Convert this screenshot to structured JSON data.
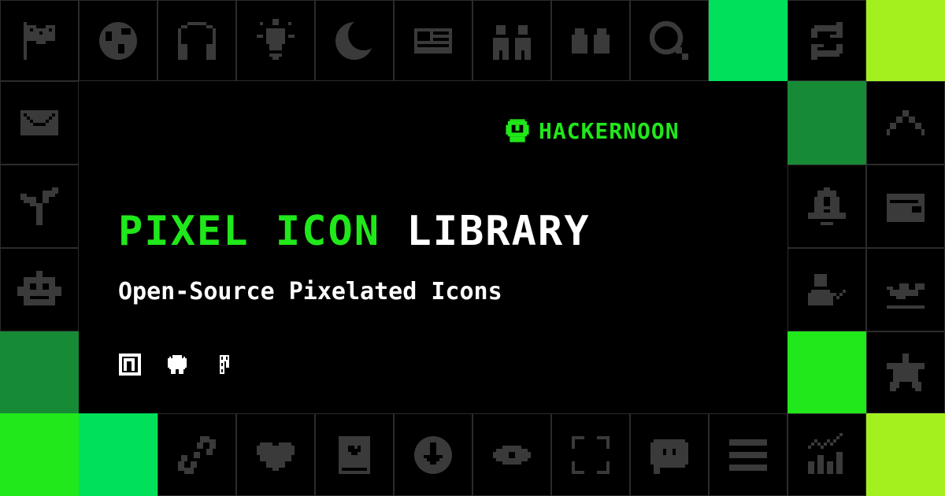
{
  "brand": {
    "name": "HACKERNOON",
    "logo_icon": "hackernoon-helmet-icon"
  },
  "hero": {
    "title_green": "PIXEL ICON",
    "title_white": "LIBRARY",
    "subtitle": "Open-Source Pixelated Icons"
  },
  "links": [
    {
      "icon": "npm-icon"
    },
    {
      "icon": "github-icon"
    },
    {
      "icon": "figma-icon"
    }
  ],
  "colors": {
    "background": "#000000",
    "accent_green": "#20e81a",
    "tile_bright_green": "#00e05a",
    "tile_dark_green": "#178a36",
    "tile_lime": "#a3f01e",
    "icon_gray": "#3a3a3a"
  },
  "icon_grid": {
    "top_row": [
      "flag-icon",
      "globe-icon",
      "headphones-icon",
      "lightbulb-icon",
      "moon-icon",
      "newspaper-icon",
      "users-icon",
      "quote-icon",
      "search-icon",
      "green-tile",
      "refresh-icon",
      "lime-tile"
    ],
    "left_column": [
      "mail-icon",
      "sprout-icon",
      "robot-icon",
      "dark-green-tile"
    ],
    "right_inner_column": [
      "dark-green-tile",
      "bell-alert-icon",
      "user-check-icon",
      "bright-green-tile"
    ],
    "right_outer_column": [
      "chevron-up-icon",
      "wallet-icon",
      "plane-departure-icon",
      "star-icon"
    ],
    "bottom_row": [
      "bright-green-tile",
      "green-tile",
      "link-icon",
      "heart-icon",
      "book-heart-icon",
      "download-icon",
      "eye-icon",
      "scan-icon",
      "chat-quote-icon",
      "menu-icon",
      "analytics-icon",
      "lime-tile"
    ]
  }
}
